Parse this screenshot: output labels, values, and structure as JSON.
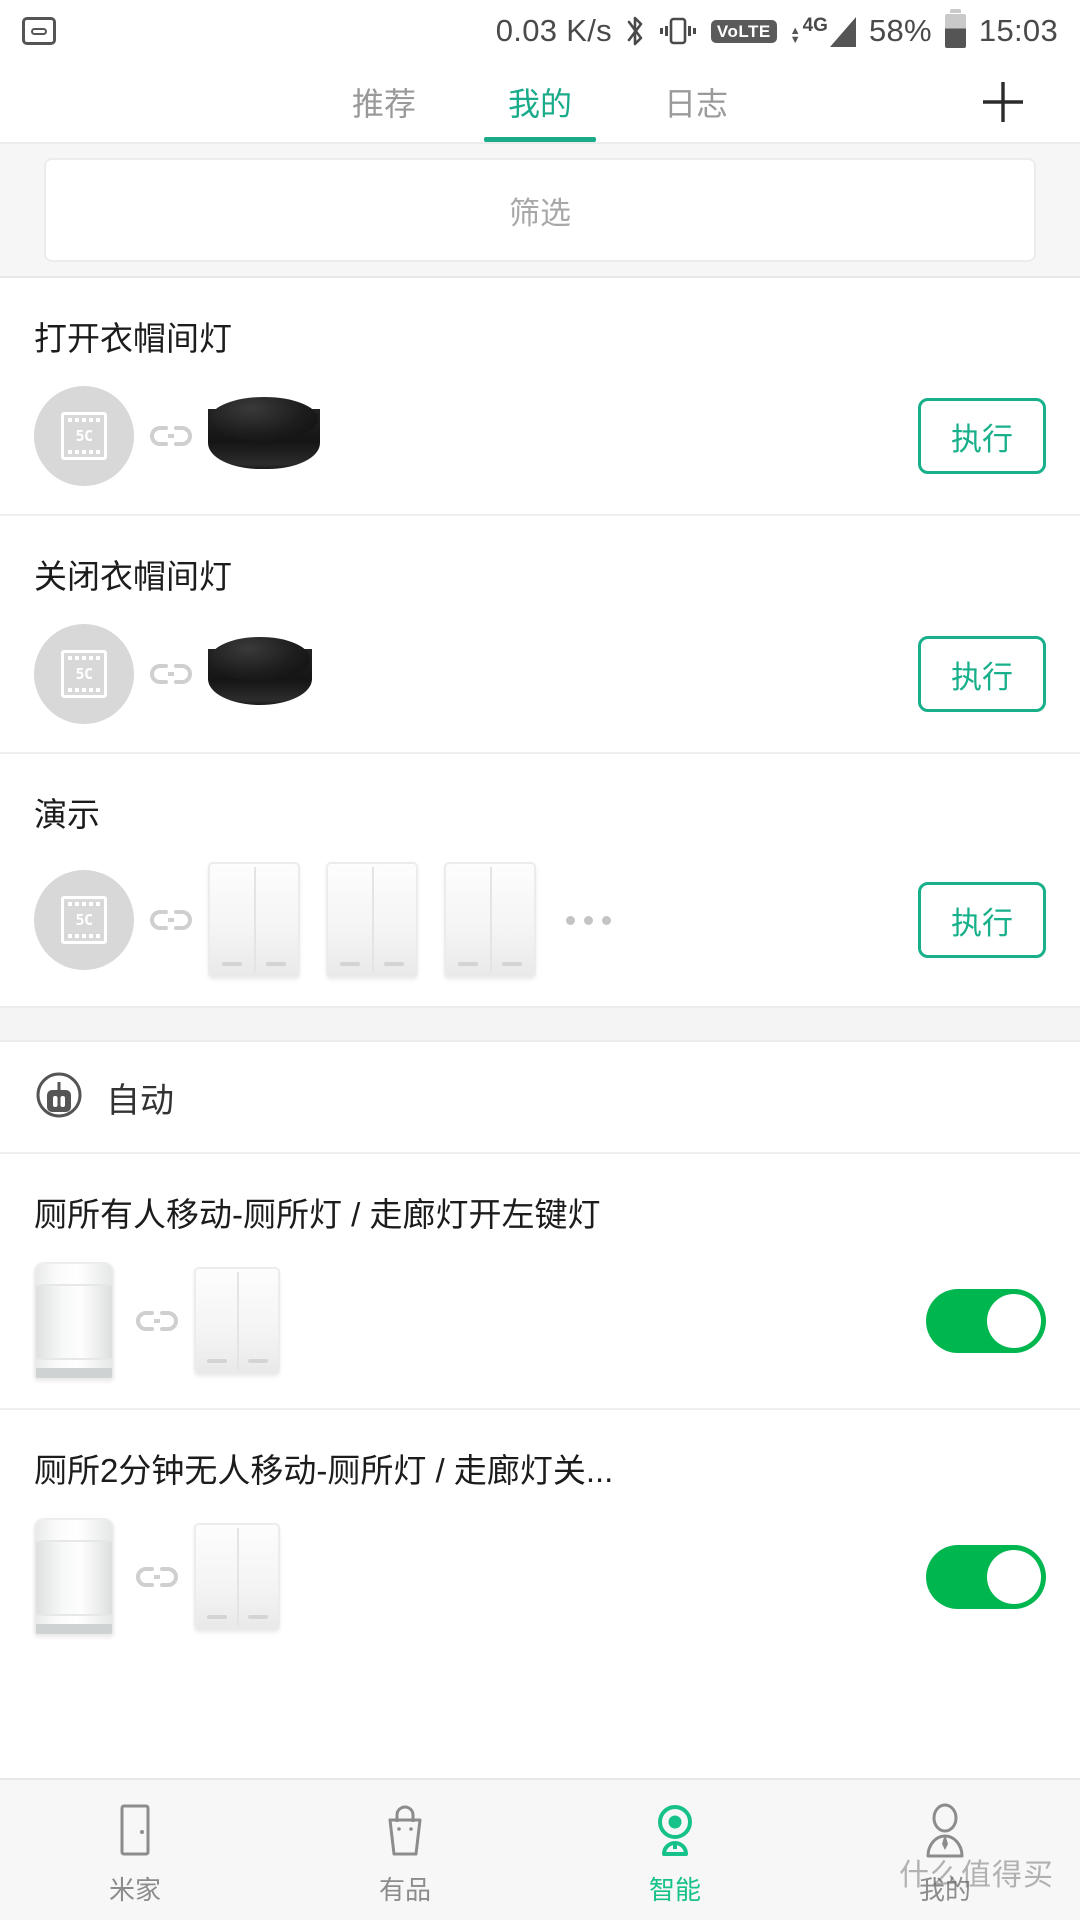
{
  "status_bar": {
    "net_speed": "0.03 K/s",
    "battery_percent": "58%",
    "time": "15:03",
    "volte_label": "VoLTE",
    "network_type": "4G",
    "icons": [
      "sim-card-icon",
      "bluetooth-icon",
      "vibrate-icon",
      "volte-icon",
      "data-transfer-icon",
      "signal-icon",
      "battery-icon"
    ]
  },
  "top_tabs": {
    "items": [
      {
        "label": "推荐",
        "active": false
      },
      {
        "label": "我的",
        "active": true
      },
      {
        "label": "日志",
        "active": false
      }
    ],
    "add_button": "plus-icon"
  },
  "filter": {
    "placeholder": "筛选"
  },
  "scenes": [
    {
      "title": "打开衣帽间灯",
      "action_label": "执行",
      "devices": [
        "scene-avatar",
        "link-icon",
        "ir-remote"
      ],
      "overflow": false
    },
    {
      "title": "关闭衣帽间灯",
      "action_label": "执行",
      "devices": [
        "scene-avatar",
        "link-icon",
        "ir-remote"
      ],
      "overflow": false
    },
    {
      "title": "演示",
      "action_label": "执行",
      "devices": [
        "scene-avatar",
        "link-icon",
        "wall-switch",
        "wall-switch",
        "wall-switch"
      ],
      "overflow": true
    }
  ],
  "automation_section": {
    "icon": "robot-icon",
    "label": "自动"
  },
  "automations": [
    {
      "title": "厕所有人移动-厕所灯 / 走廊灯开左键灯",
      "devices": [
        "motion-sensor",
        "link-icon",
        "wall-switch"
      ],
      "enabled": true
    },
    {
      "title": "厕所2分钟无人移动-厕所灯 / 走廊灯关...",
      "devices": [
        "motion-sensor",
        "link-icon",
        "wall-switch"
      ],
      "enabled": true
    }
  ],
  "bottom_nav": {
    "items": [
      {
        "label": "米家",
        "icon": "device-icon",
        "active": false
      },
      {
        "label": "有品",
        "icon": "shopping-bag-icon",
        "active": false
      },
      {
        "label": "智能",
        "icon": "smart-camera-icon",
        "active": true
      },
      {
        "label": "我的",
        "icon": "person-icon",
        "active": false
      }
    ]
  },
  "watermark": {
    "text": "什么值得买"
  },
  "colors": {
    "accent_teal": "#17b08a",
    "toggle_green": "#00b64f",
    "nav_active": "#17c28a",
    "text_primary": "#1c1c1c",
    "text_muted": "#9a9a9a"
  }
}
